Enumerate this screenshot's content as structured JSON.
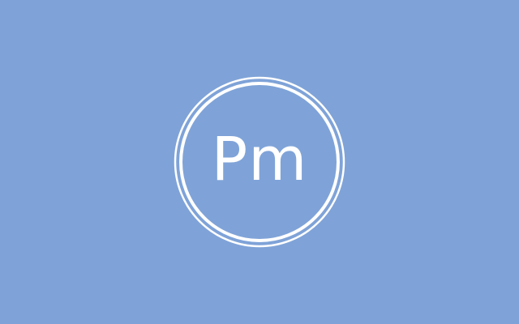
{
  "logo": {
    "text": "Pm",
    "ring_color": "#ffffff",
    "icon": "pm-logo-icon"
  },
  "colors": {
    "background": "#7fa3d8",
    "foreground": "#ffffff"
  }
}
